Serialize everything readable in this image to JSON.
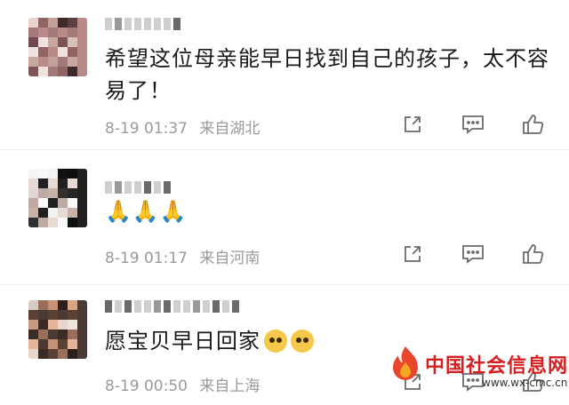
{
  "comments": [
    {
      "text_line1": "希望这位母亲能早日找到自己的孩子，太不容",
      "text_line2": "易了！",
      "date": "8-19 01:37",
      "location": "来自湖北",
      "avatar_colors": [
        "#e8d3cf",
        "#b98a88",
        "#6e4a4d",
        "#3c2a2d",
        "#c9a7a1",
        "#8f6462",
        "#d8c0bb",
        "#a47979",
        "#5e3f43",
        "#f0e3df",
        "#c3a09b",
        "#7b5558"
      ]
    },
    {
      "emoji": "🙏🙏🙏",
      "date": "8-19 01:17",
      "location": "来自河南",
      "avatar_colors": [
        "#f5f5f5",
        "#202020",
        "#e0d6d2",
        "#101010",
        "#c8b3aa",
        "#f8f8f8",
        "#262626",
        "#e7d9d4",
        "#0e0e0e",
        "#bfaaa3",
        "#f2f2f2",
        "#303030"
      ]
    },
    {
      "text": "愿宝贝早日回家",
      "date": "8-19 00:50",
      "location": "来自上海",
      "avatar_colors": [
        "#d9cbc3",
        "#4a3a33",
        "#c79a82",
        "#2b201c",
        "#e4b596",
        "#9a6e5a",
        "#efe4dc",
        "#5b4034",
        "#d7a586",
        "#3a2b25",
        "#c59276",
        "#ead7cb"
      ]
    }
  ],
  "icons": {
    "share": "share-icon",
    "comment": "comment-icon",
    "like": "thumbs-up-icon"
  },
  "watermark": {
    "title": "中国社会信息网",
    "url": "www.wx-cmc.cn"
  },
  "colors": {
    "meta_text": "#9a9a9a",
    "watermark_red": "#d42020"
  }
}
